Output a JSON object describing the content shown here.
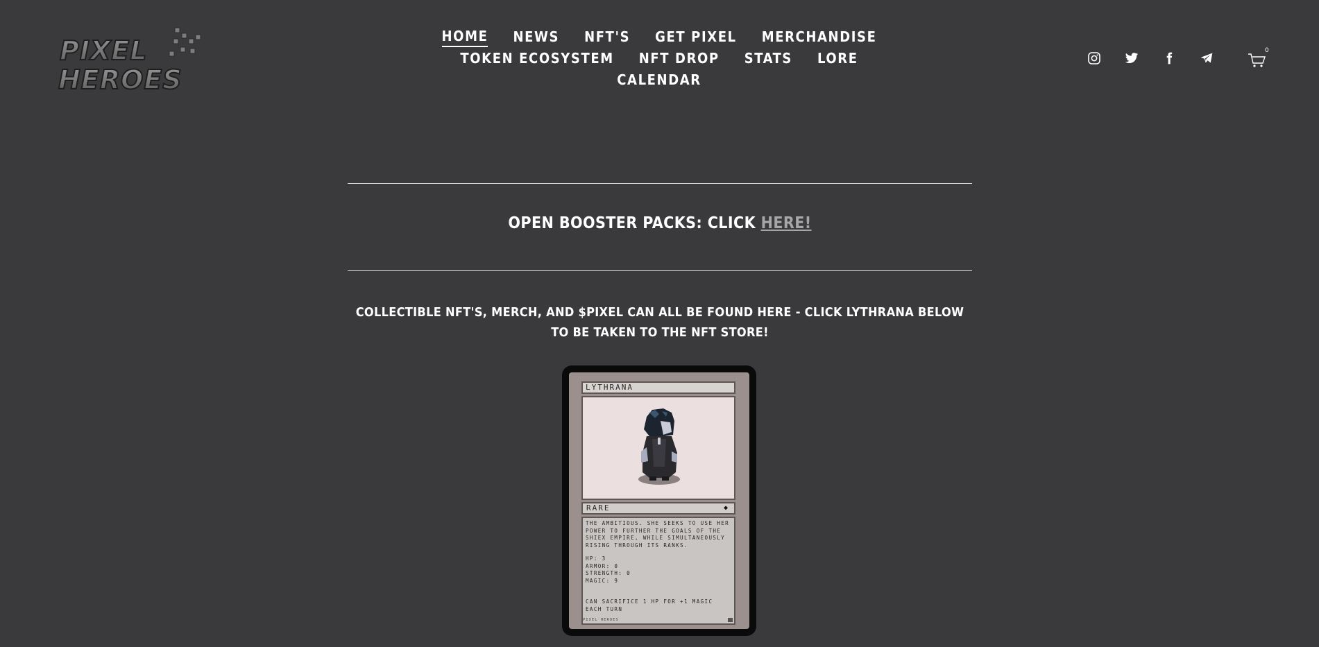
{
  "header": {
    "logo": {
      "line1": "PIXEL",
      "line2": "HEROES"
    },
    "nav_rows": [
      [
        {
          "label": "HOME",
          "active": true
        },
        {
          "label": "NEWS"
        },
        {
          "label": "NFT'S"
        },
        {
          "label": "GET PIXEL"
        },
        {
          "label": "MERCHANDISE"
        }
      ],
      [
        {
          "label": "TOKEN ECOSYSTEM"
        },
        {
          "label": "NFT DROP"
        },
        {
          "label": "STATS"
        },
        {
          "label": "LORE"
        }
      ],
      [
        {
          "label": "CALENDAR"
        }
      ]
    ],
    "social_icons": [
      "instagram-icon",
      "twitter-icon",
      "facebook-icon",
      "telegram-icon"
    ],
    "cart": {
      "icon": "cart-icon",
      "count": "0"
    }
  },
  "main": {
    "booster": {
      "text": "OPEN BOOSTER PACKS: CLICK ",
      "link": "HERE!"
    },
    "collect_text": "COLLECTIBLE NFT'S, MERCH, AND $PIXEL CAN ALL BE FOUND HERE - CLICK LYTHRANA BELOW TO BE TAKEN TO THE NFT STORE!",
    "card": {
      "name": "LYTHRANA",
      "rarity": "RARE",
      "description": "THE AMBITIOUS. SHE SEEKS TO USE HER POWER TO FURTHER THE GOALS OF THE SHIEX EMPIRE, WHILE SIMULTANEOUSLY RISING THROUGH ITS RANKS.",
      "stats": [
        "HP: 3",
        "ARMOR: 0",
        "STRENGTH: 0",
        "MAGIC: 9"
      ],
      "ability": "CAN SACRIFICE 1 HP FOR +1 MAGIC EACH TURN",
      "footer": "PIXEL HEROES"
    }
  },
  "colors": {
    "background": "#3a3a3c",
    "text": "#ffffff",
    "link": "#a6a6a6",
    "card_art_bg": "#ecdfdf"
  }
}
